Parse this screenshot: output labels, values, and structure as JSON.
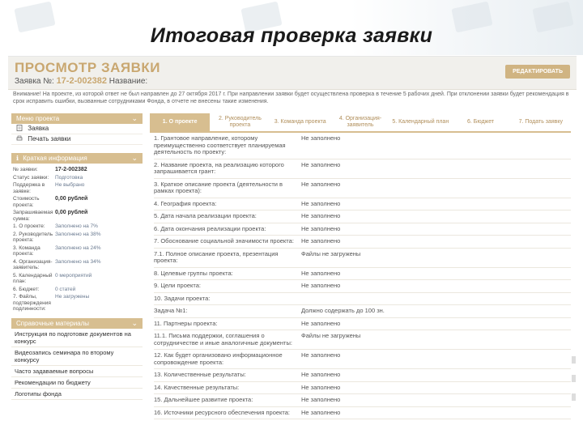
{
  "slide": {
    "title": "Итоговая проверка заявки"
  },
  "header": {
    "page_title": "ПРОСМОТР ЗАЯВКИ",
    "app_label": "Заявка №:",
    "app_number": "17-2-002382",
    "app_suffix": "Название:",
    "edit_button": "РЕДАКТИРОВАТЬ"
  },
  "notice": "Внимание! На проекте, из которой ответ не был направлен до 27 октября 2017 г. При направлении заявки будет осуществлена проверка в течение 5 рабочих дней. При отклонении заявки будет рекомендация в срок исправить ошибки, вызванные сотрудниками Фонда, в отчете не внесены такие изменения.",
  "sidebar": {
    "menu_title": "Меню проекта",
    "menu_items": [
      "Заявка",
      "Печать заявки"
    ],
    "info_title": "Краткая информация",
    "info_rows": [
      {
        "k": "№ заявки:",
        "v": "17-2-002382",
        "strong": true
      },
      {
        "k": "Статус заявки:",
        "v": "Подготовка"
      },
      {
        "k": "Поддержка в заявке:",
        "v": "Не выбрано"
      },
      {
        "k": "Стоимость проекта:",
        "v": "0,00 рублей",
        "strong": true
      },
      {
        "k": "Запрашиваемая сумма:",
        "v": "0,00 рублей",
        "strong": true
      },
      {
        "k": "1. О проекте:",
        "v": "Заполнено на 7%"
      },
      {
        "k": "2. Руководитель проекта:",
        "v": "Заполнено на 38%"
      },
      {
        "k": "3. Команда проекта:",
        "v": "Заполнено на 24%"
      },
      {
        "k": "4. Организация-заявитель:",
        "v": "Заполнено на 34%"
      },
      {
        "k": "5. Календарный план:",
        "v": "0 мероприятий"
      },
      {
        "k": "6. Бюджет:",
        "v": "0 статей"
      },
      {
        "k": "7. Файлы, подтверждения подлинности:",
        "v": "Не загружены"
      }
    ],
    "ref_title": "Справочные материалы",
    "ref_items": [
      "Инструкция по подготовке документов на конкурс",
      "Видеозапись семинара по второму конкурсу",
      "Часто задаваемые вопросы",
      "Рекомендации по бюджету",
      "Логотипы фонда"
    ]
  },
  "tabs": [
    {
      "label": "1. О проекте",
      "active": true
    },
    {
      "label": "2. Руководитель проекта",
      "active": false
    },
    {
      "label": "3. Команда проекта",
      "active": false
    },
    {
      "label": "4. Организация-заявитель",
      "active": false
    },
    {
      "label": "5. Календарный план",
      "active": false
    },
    {
      "label": "6. Бюджет",
      "active": false
    },
    {
      "label": "7. Подать заявку",
      "active": false
    }
  ],
  "form_rows": [
    {
      "q": "1. Грантовое направление, которому преимущественно соответствует планируемая деятельность по проекту:",
      "a": "Не заполнено"
    },
    {
      "q": "2. Название проекта, на реализацию которого запрашивается грант:",
      "a": "Не заполнено"
    },
    {
      "q": "3. Краткое описание проекта (деятельности в рамках проекта):",
      "a": "Не заполнено"
    },
    {
      "q": "4. География проекта:",
      "a": "Не заполнено"
    },
    {
      "q": "5. Дата начала реализации проекта:",
      "a": "Не заполнено"
    },
    {
      "q": "6. Дата окончания реализации проекта:",
      "a": "Не заполнено"
    },
    {
      "q": "7. Обоснование социальной значимости проекта:",
      "a": "Не заполнено"
    },
    {
      "q": "7.1. Полное описание проекта, презентация проекта:",
      "a": "Файлы не загружены"
    },
    {
      "q": "8. Целевые группы проекта:",
      "a": "Не заполнено"
    },
    {
      "q": "9. Цели проекта:",
      "a": "Не заполнено"
    },
    {
      "q": "10. Задачи проекта:",
      "a": ""
    },
    {
      "q": "Задача №1:",
      "a": "Должно содержать до 100 зн."
    },
    {
      "q": "11. Партнеры проекта:",
      "a": "Не заполнено"
    },
    {
      "q": "11.1. Письма поддержки, соглашения о сотрудничестве и иные аналогичные документы:",
      "a": "Файлы не загружены"
    },
    {
      "q": "12. Как будет организовано информационное сопровождение проекта:",
      "a": "Не заполнено"
    },
    {
      "q": "13. Количественные результаты:",
      "a": "Не заполнено"
    },
    {
      "q": "14. Качественные результаты:",
      "a": "Не заполнено"
    },
    {
      "q": "15. Дальнейшее развитие проекта:",
      "a": "Не заполнено"
    },
    {
      "q": "16. Источники ресурсного обеспечения проекта:",
      "a": "Не заполнено"
    }
  ]
}
